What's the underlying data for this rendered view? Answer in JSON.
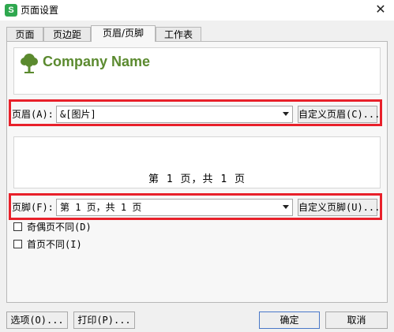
{
  "window": {
    "title": "页面设置",
    "app_icon_letter": "S",
    "close_glyph": "✕"
  },
  "tabs": [
    {
      "label": "页面",
      "active": false
    },
    {
      "label": "页边距",
      "active": false
    },
    {
      "label": "页眉/页脚",
      "active": true
    },
    {
      "label": "工作表",
      "active": false
    }
  ],
  "header": {
    "preview_logo_text": "Company Name",
    "label": "页眉(A):",
    "value": "&[图片]",
    "custom_button": "自定义页眉(C)..."
  },
  "footer": {
    "preview_text": "第 1 页，共 1 页",
    "label": "页脚(F):",
    "value": "第 1 页，共 1 页",
    "custom_button": "自定义页脚(U)..."
  },
  "options": [
    {
      "label": "奇偶页不同(D)",
      "checked": false
    },
    {
      "label": "首页不同(I)",
      "checked": false
    }
  ],
  "buttons": {
    "options": "选项(O)...",
    "print": "打印(P)...",
    "ok": "确定",
    "cancel": "取消"
  },
  "colors": {
    "highlight": "#e8202a",
    "logo": "#5b8a2f",
    "app_icon": "#2fa84f"
  }
}
